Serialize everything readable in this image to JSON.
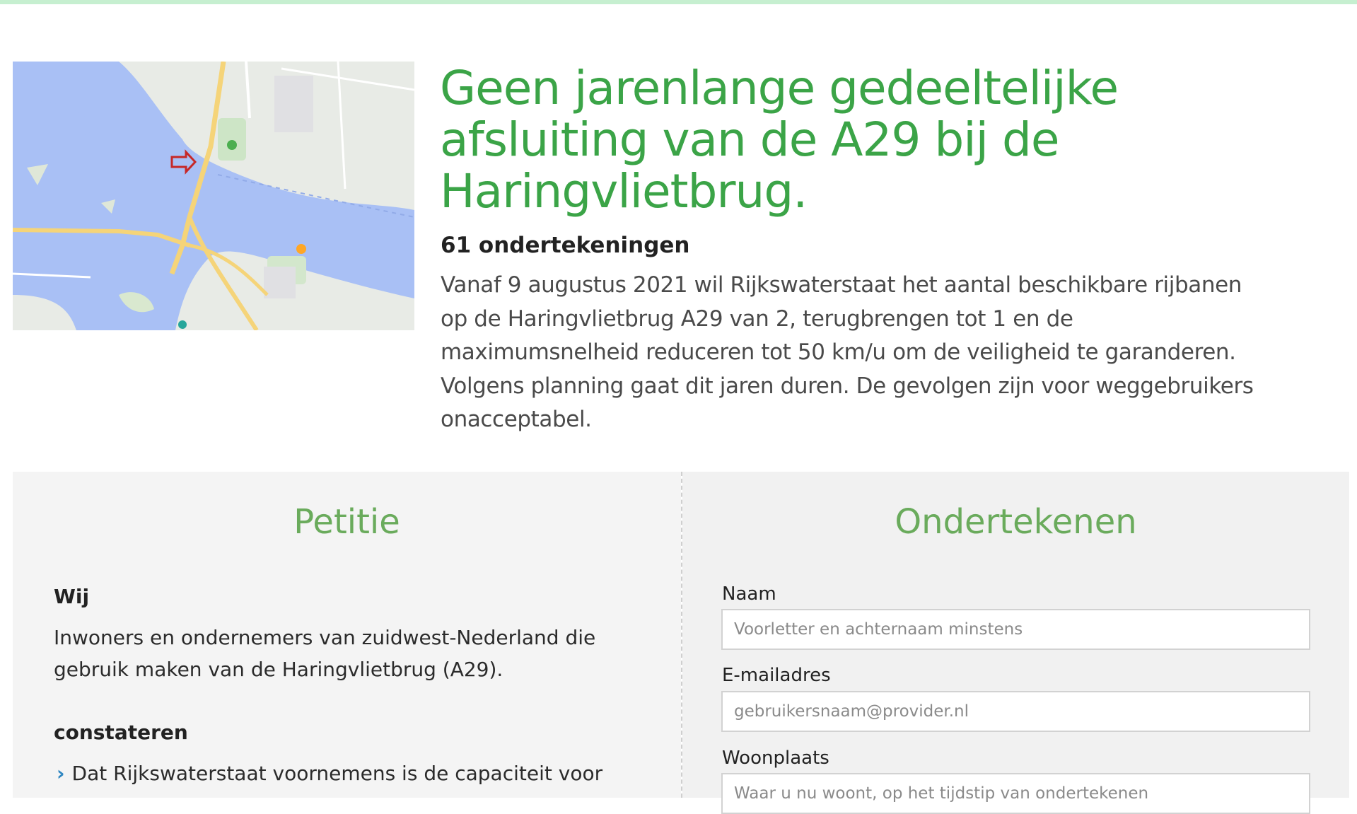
{
  "page": {
    "title": "Geen jarenlange gedeeltelijke afsluiting van de A29 bij de Haringvlietbrug.",
    "signature_count": "61 ondertekeningen",
    "intro": "Vanaf 9 augustus 2021 wil Rijkswaterstaat het aantal beschikbare rijbanen op de Haringvlietbrug A29 van 2, terugbrengen tot 1 en de maximumsnelheid reduceren tot 50 km/u om de veiligheid te garanderen. Volgens planning gaat dit jaren duren. De gevolgen zijn voor weggebruikers onacceptabel."
  },
  "petition": {
    "heading": "Petitie",
    "wij_label": "Wij",
    "wij_text": "Inwoners en ondernemers van zuidwest-Nederland die gebruik maken van de Haringvlietbrug (A29).",
    "constateren_label": "constateren",
    "bullet_1": "Dat Rijkswaterstaat voornemens is de capaciteit voor"
  },
  "sign": {
    "heading": "Ondertekenen",
    "name_label": "Naam",
    "name_placeholder": "Voorletter en achternaam minstens",
    "email_label": "E-mailadres",
    "email_placeholder": "gebruikersnaam@provider.nl",
    "city_label": "Woonplaats",
    "city_placeholder": "Waar u nu woont, op het tijdstip van ondertekenen"
  },
  "colors": {
    "accent_green": "#3ba447",
    "heading_green": "#6aab5c",
    "top_bar": "#c6efd0",
    "water": "#a7bff5",
    "land": "#e9ece8"
  },
  "icons": {
    "map_arrow": "red-arrow-icon",
    "map_pin": "location-pin-icon",
    "bullet": "chevron-right-icon"
  }
}
